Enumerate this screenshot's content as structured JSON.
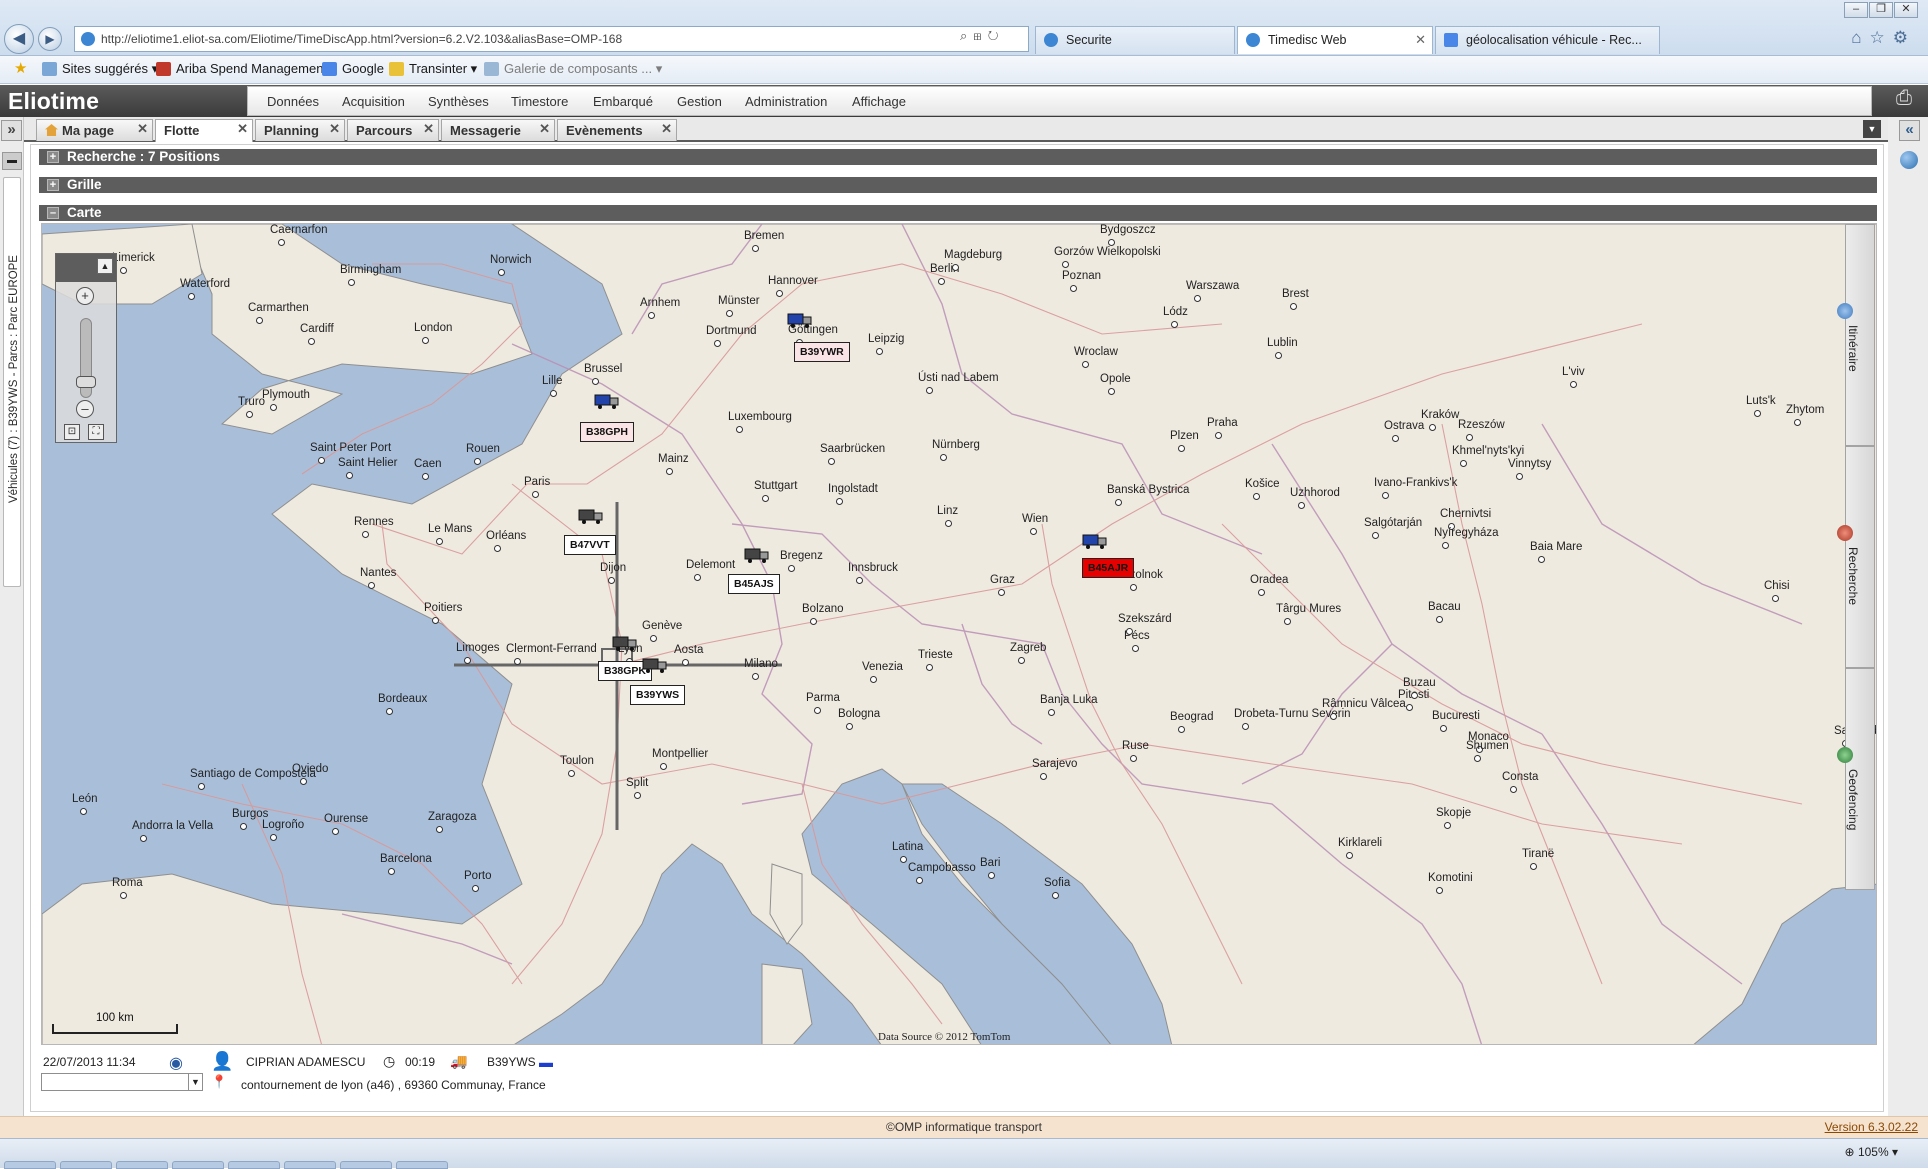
{
  "browser": {
    "url": "http://eliotime1.eliot-sa.com/Eliotime/TimeDiscApp.html?version=6.2.V2.103&aliasBase=OMP-168",
    "tabs": [
      {
        "title": "Securite"
      },
      {
        "title": "Timedisc Web"
      },
      {
        "title": "géolocalisation véhicule - Rec..."
      }
    ],
    "favorites": [
      "Sites suggérés ▾",
      "Ariba Spend Management",
      "Google",
      "Transinter ▾",
      "Galerie de composants ... ▾"
    ],
    "zoom": "105%"
  },
  "app": {
    "title": "Eliotime",
    "menu": [
      "Données",
      "Acquisition",
      "Synthèses",
      "Timestore",
      "Embarqué",
      "Gestion",
      "Administration",
      "Affichage"
    ],
    "tabs": [
      "Ma page",
      "Flotte",
      "Planning",
      "Parcours",
      "Messagerie",
      "Evènements"
    ],
    "active_tab": "Flotte",
    "left_panel_label": "Véhicules (7) : B39YWS - Parcs : Parc EUROPE",
    "sections": {
      "search": "Recherche : 7 Positions",
      "grid": "Grille",
      "map": "Carte"
    }
  },
  "map": {
    "side_tabs": [
      "Itinéraire",
      "Recherche",
      "Geofencing"
    ],
    "scale": "100 km",
    "credit": "Data Source © 2012 TomTom",
    "vehicles": [
      {
        "label": "B39YWR",
        "style": "pink"
      },
      {
        "label": "B38GPH",
        "style": "pink"
      },
      {
        "label": "B47VVT",
        "style": "white"
      },
      {
        "label": "B45AJS",
        "style": "white"
      },
      {
        "label": "B38GPK",
        "style": "white"
      },
      {
        "label": "B39YWS",
        "style": "white"
      },
      {
        "label": "B45AJR",
        "style": "red"
      }
    ],
    "cities": [
      "Caernarfon",
      "Limerick",
      "Waterford",
      "Birmingham",
      "Norwich",
      "Carmarthen",
      "Cardiff",
      "London",
      "Plymouth",
      "Truro",
      "Saint Peter Port",
      "Saint Helier",
      "Caen",
      "Rouen",
      "Lille",
      "Brussel",
      "Arnhem",
      "Münster",
      "Dortmund",
      "Bremen",
      "Hannover",
      "Göttingen",
      "Berlin",
      "Magdeburg",
      "Gorzów Wielkopolski",
      "Bydgoszcz",
      "Poznan",
      "Warszawa",
      "Brest",
      "Leipzig",
      "Wroclaw",
      "Lublin",
      "Lódz",
      "Ústi nad Labem",
      "Opole",
      "Luxembourg",
      "Mainz",
      "Saarbrücken",
      "Nürnberg",
      "Praha",
      "Plzen",
      "Ostrava",
      "Kraków",
      "Rzeszów",
      "L'viv",
      "Luts'k",
      "Zhytom",
      "Paris",
      "Rennes",
      "Le Mans",
      "Orléans",
      "Nantes",
      "Poitiers",
      "Dijon",
      "Delemont",
      "Stuttgart",
      "Ingolstadt",
      "Linz",
      "Wien",
      "Banská Bystrica",
      "Košice",
      "Uzhhorod",
      "Ivano-Frankivs'k",
      "Khmel'nyts'kyi",
      "Vinnytsy",
      "Chernivtsi",
      "Salgótarján",
      "Nyíregyháza",
      "Baia Mare",
      "Bregenz",
      "Innsbruck",
      "Graz",
      "Szolnok",
      "Oradea",
      "Chisi",
      "Limoges",
      "Clermont-Ferrand",
      "Lyon",
      "Genève",
      "Aosta",
      "Milano",
      "Bolzano",
      "Venezia",
      "Trieste",
      "Zagreb",
      "Pécs",
      "Szekszárd",
      "Târgu Mures",
      "Bacau",
      "Bordeaux",
      "Parma",
      "Bologna",
      "Banja Luka",
      "Beograd",
      "Drobeta-Turnu Severin",
      "Râmnicu Vâlcea",
      "Pitesti",
      "Buzau",
      "Bucuresti",
      "Monaco",
      "Montpellier",
      "Toulon",
      "Split",
      "Sarajevo",
      "Ruse",
      "Shumen",
      "Consta",
      "Santander",
      "Oviedo",
      "Santiago de Compostela",
      "León",
      "Burgos",
      "Logroño",
      "Ourense",
      "Andorra la Vella",
      "Zaragoza",
      "Barcelona",
      "Porto",
      "Roma",
      "Latina",
      "Campobasso",
      "Bari",
      "Sofia",
      "Skopje",
      "Kirklareli",
      "Tiranë",
      "Komotini"
    ]
  },
  "info": {
    "datetime": "22/07/2013 11:34",
    "driver": "CIPRIAN ADAMESCU",
    "duration": "00:19",
    "vehicle": "B39YWS",
    "address": "contournement de lyon (a46) , 69360 Communay, France"
  },
  "footer": {
    "copyright": "©OMP informatique transport",
    "version": "Version 6.3.02.22"
  },
  "colors": {
    "sea": "#a9bfd9",
    "land": "#efeae0",
    "route": "#d98c8c",
    "header": "#3f3f3f",
    "alert_red": "#e60000"
  }
}
